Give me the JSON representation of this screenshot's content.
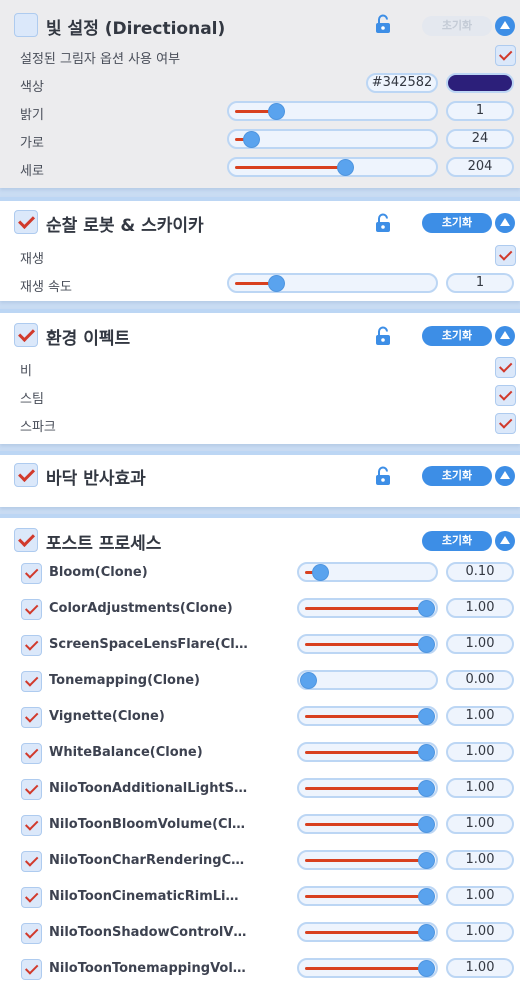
{
  "reset_label": "초기화",
  "directional": {
    "title": "빛 설정 (Directional)",
    "enabled": false,
    "use_shadow_label": "설정된 그림자 옵션 사용 여부",
    "use_shadow_checked": true,
    "color_label": "색상",
    "color_hex": "#342582",
    "color_value": "#2c1f7a",
    "brightness_label": "밝기",
    "brightness_value": "1",
    "brightness_fraction": 0.2,
    "horizontal_label": "가로",
    "horizontal_value": "24",
    "horizontal_fraction": 0.07,
    "vertical_label": "세로",
    "vertical_value": "204",
    "vertical_fraction": 0.57
  },
  "patrol": {
    "title": "순찰 로봇 & 스카이카",
    "enabled": true,
    "play_label": "재생",
    "play_checked": true,
    "speed_label": "재생 속도",
    "speed_value": "1",
    "speed_fraction": 0.2
  },
  "env_effects": {
    "title": "환경 이펙트",
    "enabled": true,
    "rain_label": "비",
    "steam_label": "스팀",
    "spark_label": "스파크"
  },
  "floor_reflection": {
    "title": "바닥 반사효과",
    "enabled": true
  },
  "post_process": {
    "title": "포스트 프로세스",
    "enabled": true,
    "items": [
      {
        "label": "Bloom(Clone)",
        "value": "0.10",
        "fraction": 0.1
      },
      {
        "label": "ColorAdjustments(Clone)",
        "value": "1.00",
        "fraction": 1.0
      },
      {
        "label": "ScreenSpaceLensFlare(Cl…",
        "value": "1.00",
        "fraction": 1.0
      },
      {
        "label": "Tonemapping(Clone)",
        "value": "0.00",
        "fraction": 0.0
      },
      {
        "label": "Vignette(Clone)",
        "value": "1.00",
        "fraction": 1.0
      },
      {
        "label": "WhiteBalance(Clone)",
        "value": "1.00",
        "fraction": 1.0
      },
      {
        "label": "NiloToonAdditionalLightS…",
        "value": "1.00",
        "fraction": 1.0
      },
      {
        "label": "NiloToonBloomVolume(Cl…",
        "value": "1.00",
        "fraction": 1.0
      },
      {
        "label": "NiloToonCharRenderingC…",
        "value": "1.00",
        "fraction": 1.0
      },
      {
        "label": "NiloToonCinematicRimLi…",
        "value": "1.00",
        "fraction": 1.0
      },
      {
        "label": "NiloToonShadowControlV…",
        "value": "1.00",
        "fraction": 1.0
      },
      {
        "label": "NiloToonTonemappingVol…",
        "value": "1.00",
        "fraction": 1.0
      }
    ]
  },
  "icons": {
    "lock": "unlock-icon",
    "collapse": "chevron-up-icon",
    "checkbox": "checkmark-icon"
  }
}
